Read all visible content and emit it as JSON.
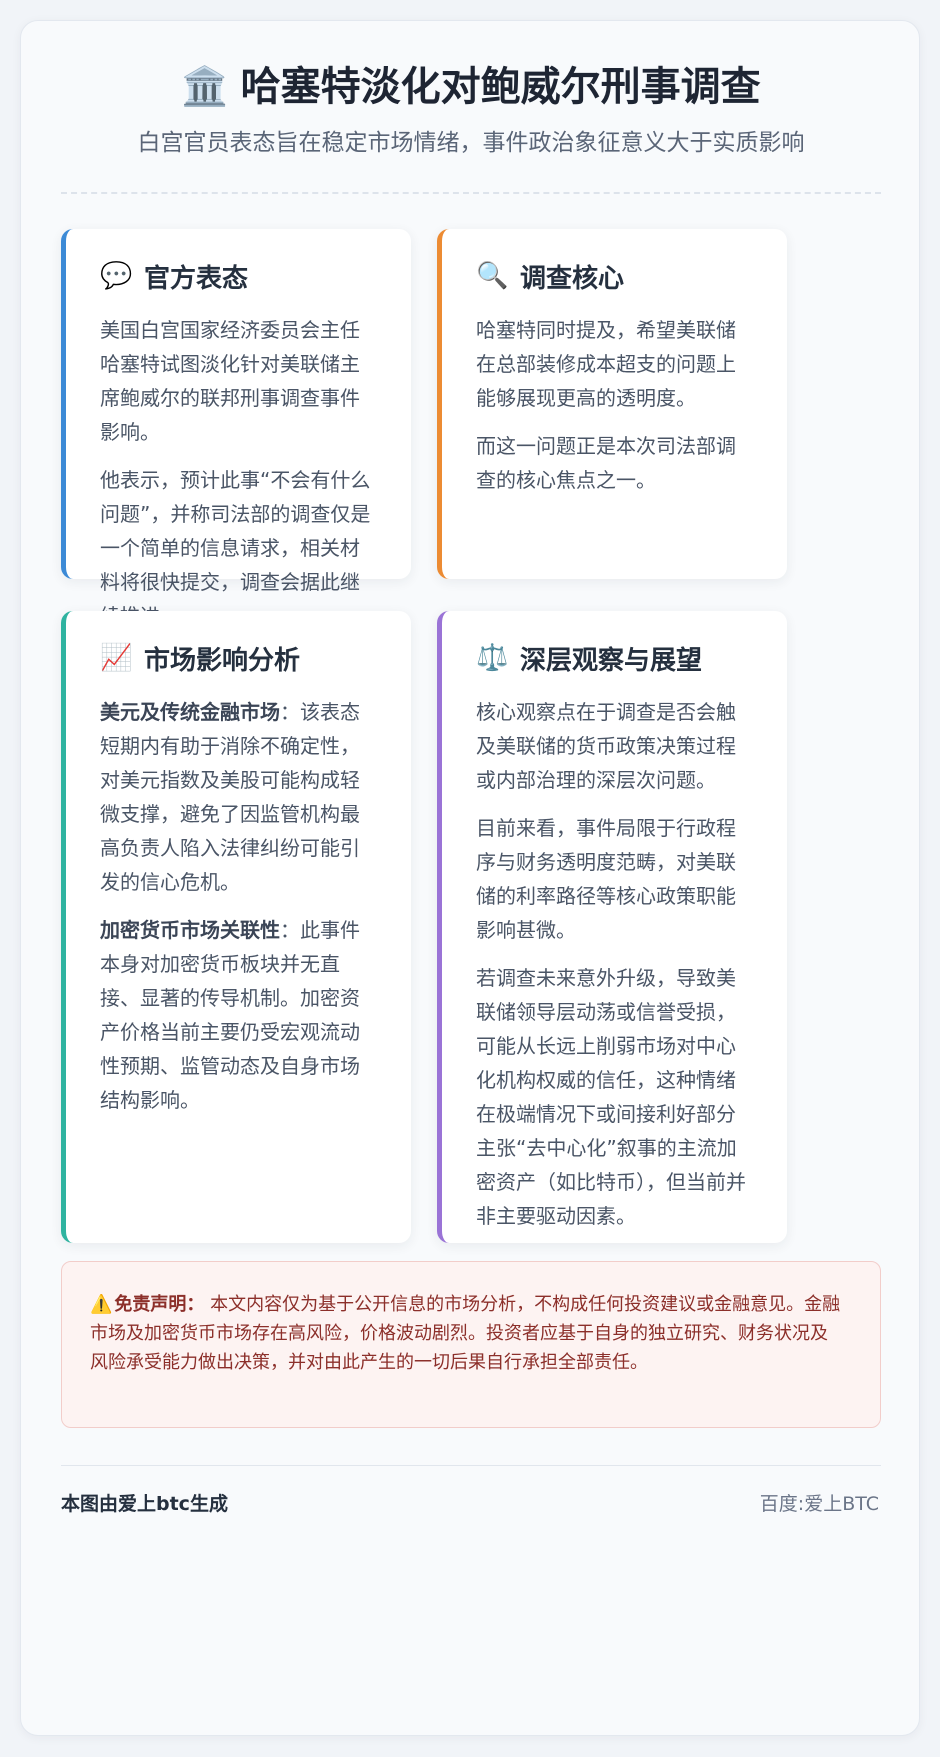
{
  "header": {
    "icon": "🏛️",
    "title": "哈塞特淡化对鲍威尔刑事调查",
    "subtitle": "白宫官员表态旨在稳定市场情绪，事件政治象征意义大于实质影响"
  },
  "cards": [
    {
      "icon": "💬",
      "title": "官方表态",
      "accent": "#3c8ad6",
      "paragraphs": [
        {
          "text": "美国白宫国家经济委员会主任哈塞特试图淡化针对美联储主席鲍威尔的联邦刑事调查事件影响。"
        },
        {
          "text": "他表示，预计此事“不会有什么问题”，并称司法部的调查仅是一个简单的信息请求，相关材料将很快提交，调查会据此继续推进。"
        }
      ]
    },
    {
      "icon": "🔍",
      "title": "调查核心",
      "accent": "#ec8b33",
      "paragraphs": [
        {
          "text": "哈塞特同时提及，希望美联储在总部装修成本超支的问题上能够展现更高的透明度。"
        },
        {
          "text": "而这一问题正是本次司法部调查的核心焦点之一。"
        }
      ]
    },
    {
      "icon": "📈",
      "title": "市场影响分析",
      "accent": "#2fb3a0",
      "paragraphs": [
        {
          "lead": "美元及传统金融市场",
          "text": "：该表态短期内有助于消除不确定性，对美元指数及美股可能构成轻微支撑，避免了因监管机构最高负责人陷入法律纠纷可能引发的信心危机。"
        },
        {
          "lead": "加密货币市场关联性",
          "text": "：此事件本身对加密货币板块并无直接、显著的传导机制。加密资产价格当前主要仍受宏观流动性预期、监管动态及自身市场结构影响。"
        }
      ]
    },
    {
      "icon": "⚖️",
      "title": "深层观察与展望",
      "accent": "#9a73d6",
      "paragraphs": [
        {
          "text": "核心观察点在于调查是否会触及美联储的货币政策决策过程或内部治理的深层次问题。"
        },
        {
          "text": "目前来看，事件局限于行政程序与财务透明度范畴，对美联储的利率路径等核心政策职能影响甚微。"
        },
        {
          "text": "若调查未来意外升级，导致美联储领导层动荡或信誉受损，可能从长远上削弱市场对中心化机构权威的信任，这种情绪在极端情况下或间接利好部分主张“去中心化”叙事的主流加密资产（如比特币），但当前并非主要驱动因素。"
        }
      ]
    }
  ],
  "disclaimer": {
    "icon": "⚠️",
    "label": "免责声明：",
    "text": "本文内容仅为基于公开信息的市场分析，不构成任何投资建议或金融意见。金融市场及加密货币市场存在高风险，价格波动剧烈。投资者应基于自身的独立研究、财务状况及风险承受能力做出决策，并对由此产生的一切后果自行承担全部责任。"
  },
  "footer": {
    "left": "本图由爱上btc生成",
    "right": "百度:爱上BTC"
  }
}
